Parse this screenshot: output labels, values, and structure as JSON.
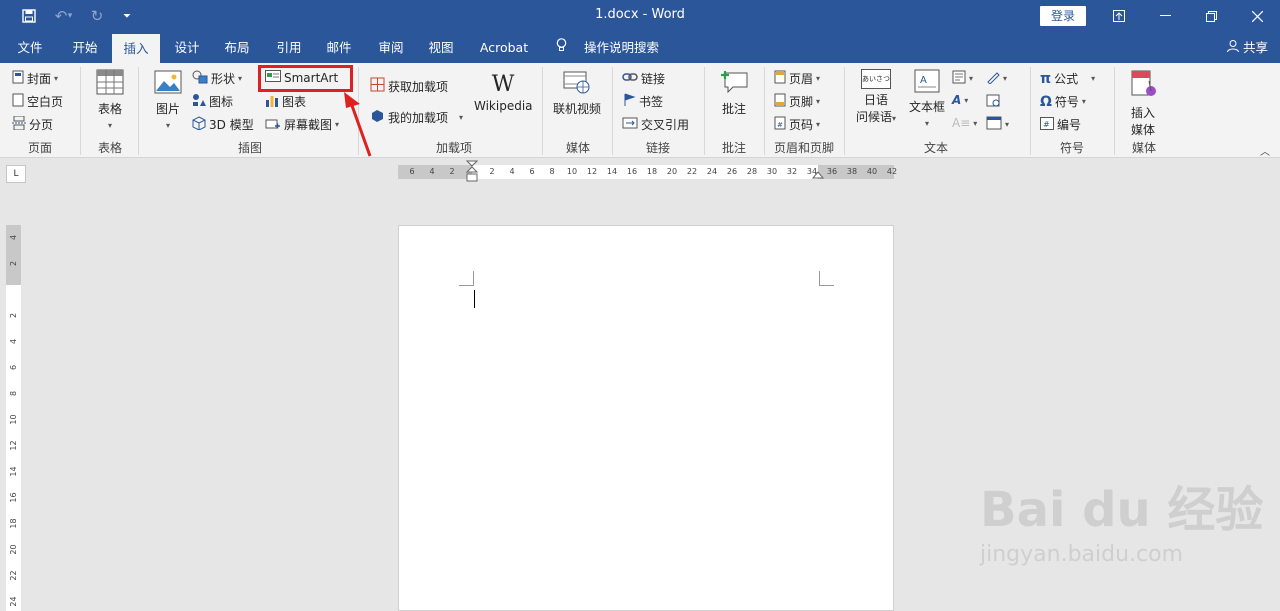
{
  "window": {
    "title": "1.docx  -  Word",
    "login_label": "登录"
  },
  "tabs": [
    {
      "label": "文件"
    },
    {
      "label": "开始"
    },
    {
      "label": "插入"
    },
    {
      "label": "设计"
    },
    {
      "label": "布局"
    },
    {
      "label": "引用"
    },
    {
      "label": "邮件"
    },
    {
      "label": "审阅"
    },
    {
      "label": "视图"
    },
    {
      "label": "Acrobat"
    }
  ],
  "active_tab": "插入",
  "search_label": "操作说明搜索",
  "share_label": "共享",
  "ribbon": {
    "pages": {
      "cover": "封面",
      "blank": "空白页",
      "break": "分页",
      "group": "页面"
    },
    "tables": {
      "table": "表格",
      "group": "表格"
    },
    "illustrations": {
      "picture": "图片",
      "shapes": "形状",
      "icons": "图标",
      "model3d": "3D 模型",
      "smartart": "SmartArt",
      "chart": "图表",
      "screenshot": "屏幕截图",
      "group": "插图"
    },
    "addins": {
      "get": "获取加载项",
      "my": "我的加载项",
      "wikipedia": "Wikipedia",
      "group": "加载项"
    },
    "media": {
      "online_video": "联机视频",
      "group": "媒体"
    },
    "links": {
      "link": "链接",
      "bookmark": "书签",
      "cross_ref": "交叉引用",
      "group": "链接"
    },
    "comments": {
      "comment": "批注",
      "group": "批注"
    },
    "header_footer": {
      "header": "页眉",
      "footer": "页脚",
      "page_number": "页码",
      "group": "页眉和页脚"
    },
    "text": {
      "japanese_line1": "日语",
      "japanese_line2": "问候语",
      "textbox": "文本框",
      "group": "文本",
      "jp_icon_text": "あいさつ"
    },
    "symbols": {
      "equation": "公式",
      "symbol": "符号",
      "number": "编号",
      "group": "符号"
    },
    "insert_media": {
      "line1": "插入",
      "line2": "媒体",
      "group": "媒体"
    }
  },
  "ruler": {
    "horizontal_ticks": [
      "6",
      "4",
      "2",
      "2",
      "4",
      "6",
      "8",
      "10",
      "12",
      "14",
      "16",
      "18",
      "20",
      "22",
      "24",
      "26",
      "28",
      "30",
      "32",
      "34",
      "36",
      "38",
      "40",
      "42"
    ],
    "vertical_ticks": [
      "4",
      "2",
      "2",
      "4",
      "6",
      "8",
      "10",
      "12",
      "14",
      "16",
      "18",
      "20",
      "22",
      "24"
    ],
    "tab_marker": "L"
  },
  "watermark": {
    "main": "Bai du 经验",
    "sub": "jingyan.baidu.com"
  },
  "colors": {
    "brand": "#2b579a",
    "highlight": "#e02020",
    "ribbon_bg": "#f3f3f3"
  }
}
